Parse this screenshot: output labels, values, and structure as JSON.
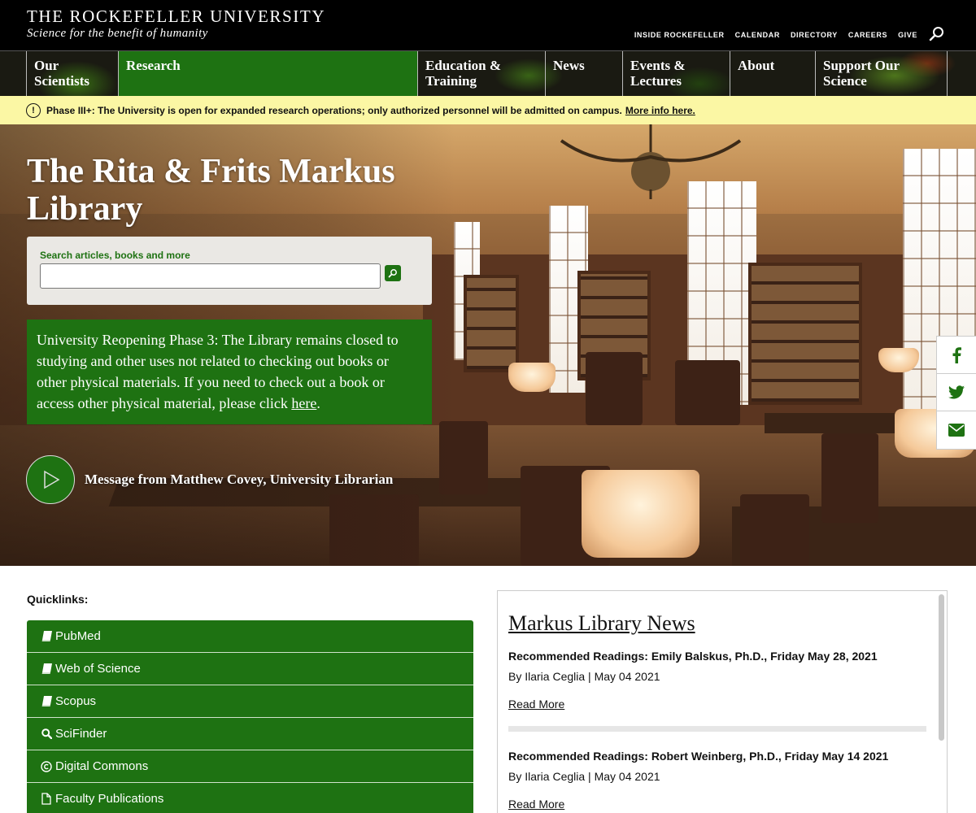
{
  "header": {
    "brand_name": "THE ROCKEFELLER UNIVERSITY",
    "tagline": "Science for the benefit of humanity",
    "utility_links": [
      "INSIDE ROCKEFELLER",
      "CALENDAR",
      "DIRECTORY",
      "CAREERS",
      "GIVE"
    ],
    "search_icon": "search-icon"
  },
  "nav": {
    "items": [
      {
        "label": "Our Scientists"
      },
      {
        "label": "Research",
        "active": true
      },
      {
        "label": "Education & Training"
      },
      {
        "label": "News"
      },
      {
        "label": "Events & Lectures"
      },
      {
        "label": "About"
      },
      {
        "label": "Support Our Science"
      }
    ]
  },
  "alert": {
    "icon": "exclamation-icon",
    "prefix": "Phase III+:",
    "text": "The University is open for expanded research operations; only authorized personnel will be admitted on campus.",
    "link": "More info here."
  },
  "hero": {
    "title": "The Rita & Frits Markus Library",
    "search_label": "Search articles, books and more",
    "search_value": "",
    "reopen_text": "University Reopening Phase 3: The Library remains closed to studying and other uses not related to checking out books or other physical materials. If you need to check out a book or access other physical material, please click",
    "reopen_link": "here",
    "reopen_end": ".",
    "video_label": "Message from Matthew Covey, University Librarian"
  },
  "social": [
    "facebook-icon",
    "twitter-icon",
    "envelope-icon"
  ],
  "quicklinks": {
    "heading": "Quicklinks:",
    "items": [
      {
        "label": "PubMed",
        "icon": "book-icon"
      },
      {
        "label": "Web of Science",
        "icon": "book-icon"
      },
      {
        "label": "Scopus",
        "icon": "book-icon"
      },
      {
        "label": "SciFinder",
        "icon": "search-icon"
      },
      {
        "label": "Digital Commons",
        "icon": "copyright-icon"
      },
      {
        "label": "Faculty Publications",
        "icon": "file-icon"
      }
    ]
  },
  "news": {
    "title": "Markus Library News",
    "items": [
      {
        "headline": "Recommended Readings: Emily Balskus, Ph.D., Friday May 28, 2021",
        "meta": "By Ilaria Ceglia | May 04 2021",
        "more": "Read More"
      },
      {
        "headline": "Recommended Readings: Robert Weinberg, Ph.D., Friday May 14 2021",
        "meta": "By Ilaria Ceglia | May 04 2021",
        "more": "Read More"
      }
    ]
  },
  "colors": {
    "brand_green": "#1e7212",
    "alert_yellow": "#fbf7a4",
    "header_black": "#000000"
  }
}
